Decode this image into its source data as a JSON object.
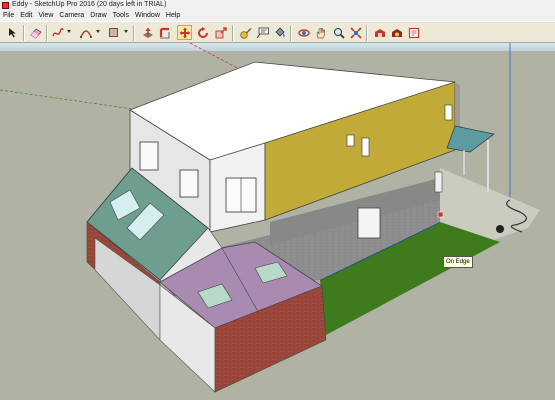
{
  "window": {
    "title": "Eddy - SketchUp Pro 2016 (20 days left in TRIAL)"
  },
  "menu": [
    {
      "id": "file",
      "label": "File"
    },
    {
      "id": "edit",
      "label": "Edit"
    },
    {
      "id": "view",
      "label": "View"
    },
    {
      "id": "camera",
      "label": "Camera"
    },
    {
      "id": "draw",
      "label": "Draw"
    },
    {
      "id": "tools",
      "label": "Tools"
    },
    {
      "id": "window",
      "label": "Window"
    },
    {
      "id": "help",
      "label": "Help"
    }
  ],
  "toolbar": {
    "tools": [
      {
        "icon": "select-arrow-icon"
      },
      {
        "icon": "eraser-icon"
      },
      {
        "icon": "freehand-line-icon"
      },
      {
        "icon": "arc-icon"
      },
      {
        "icon": "rectangle-icon"
      },
      {
        "icon": "push-pull-icon"
      },
      {
        "icon": "follow-me-icon"
      },
      {
        "icon": "move-icon",
        "active": true
      },
      {
        "icon": "rotate-icon"
      },
      {
        "icon": "scale-icon"
      },
      {
        "icon": "tape-measure-icon"
      },
      {
        "icon": "text-label-icon"
      },
      {
        "icon": "paint-bucket-icon"
      },
      {
        "icon": "orbit-icon"
      },
      {
        "icon": "pan-hand-icon"
      },
      {
        "icon": "zoom-icon"
      },
      {
        "icon": "zoom-extents-icon"
      },
      {
        "icon": "3d-warehouse-icon"
      },
      {
        "icon": "extension-warehouse-icon"
      },
      {
        "icon": "layout-send-icon"
      }
    ]
  },
  "viewport": {
    "tooltip": "On Edge",
    "colors": {
      "sky": "#c6d9e3",
      "ground": "#b2b4a4",
      "lawn": "#3f7a1c",
      "yellow_wall": "#c0a838",
      "brick": "#a14b3d",
      "roof_green": "#6f9f92",
      "roof_purple": "#a98ab0",
      "siding_gray": "#8a8a8a"
    }
  }
}
